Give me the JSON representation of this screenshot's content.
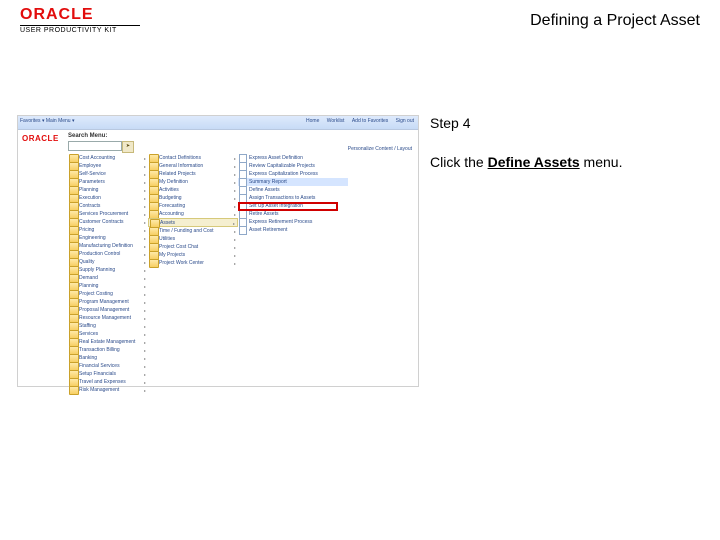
{
  "header": {
    "logo_brand": "ORACLE",
    "logo_sub": "USER PRODUCTIVITY KIT",
    "page_title": "Defining a Project Asset"
  },
  "instruction": {
    "step_label": "Step 4",
    "action_prefix": "Click the ",
    "action_target": "Define Assets",
    "action_suffix": " menu."
  },
  "screenshot": {
    "topbar_left": "Favorites ▾   Main Menu ▾",
    "topbar_links": [
      "Home",
      "Worklist",
      "Add to Favorites",
      "Sign out"
    ],
    "brand": "ORACLE",
    "search_label": "Search Menu:",
    "go_btn": "➤",
    "personalize": "Personalize Content / Layout",
    "col1": [
      "Cost Accounting",
      "Employee",
      "Self-Service",
      "Parameters",
      "Planning",
      "Execution",
      "Contracts",
      "Services Procurement",
      "Customer Contracts",
      "Pricing",
      "Engineering",
      "Manufacturing Definition",
      "Production Control",
      "Quality",
      "Supply Planning",
      "Demand",
      "Planning",
      "Project Costing",
      "Program Management",
      "Proposal Management",
      "Resource Management",
      "Staffing",
      "Services",
      "Real Estate Management",
      "Transaction Billing",
      "Banking",
      "Financial Services",
      "Setup Financials",
      "Travel and Expenses",
      "Risk Management"
    ],
    "col2": [
      "Contact Definitions",
      "General Information",
      "Related Projects",
      "My Definition",
      "Activities",
      "Budgeting",
      "Forecasting",
      "Accounting",
      "Assets",
      "Time / Funding and Cost",
      "Utilities",
      "Project Cost Chat",
      "My Projects",
      "Project Work Center"
    ],
    "col2_active_idx": 8,
    "col3": [
      "Express Asset Definition",
      "Review Capitalizable Projects",
      "Express Capitalization Process",
      "Summary Report",
      "Define Assets",
      "Assign Transactions to Assets",
      "Set Up Asset Integration",
      "Retire Assets",
      "Express Retirement Process",
      "Asset Retirement"
    ],
    "col3_highlight_idx": 3
  }
}
